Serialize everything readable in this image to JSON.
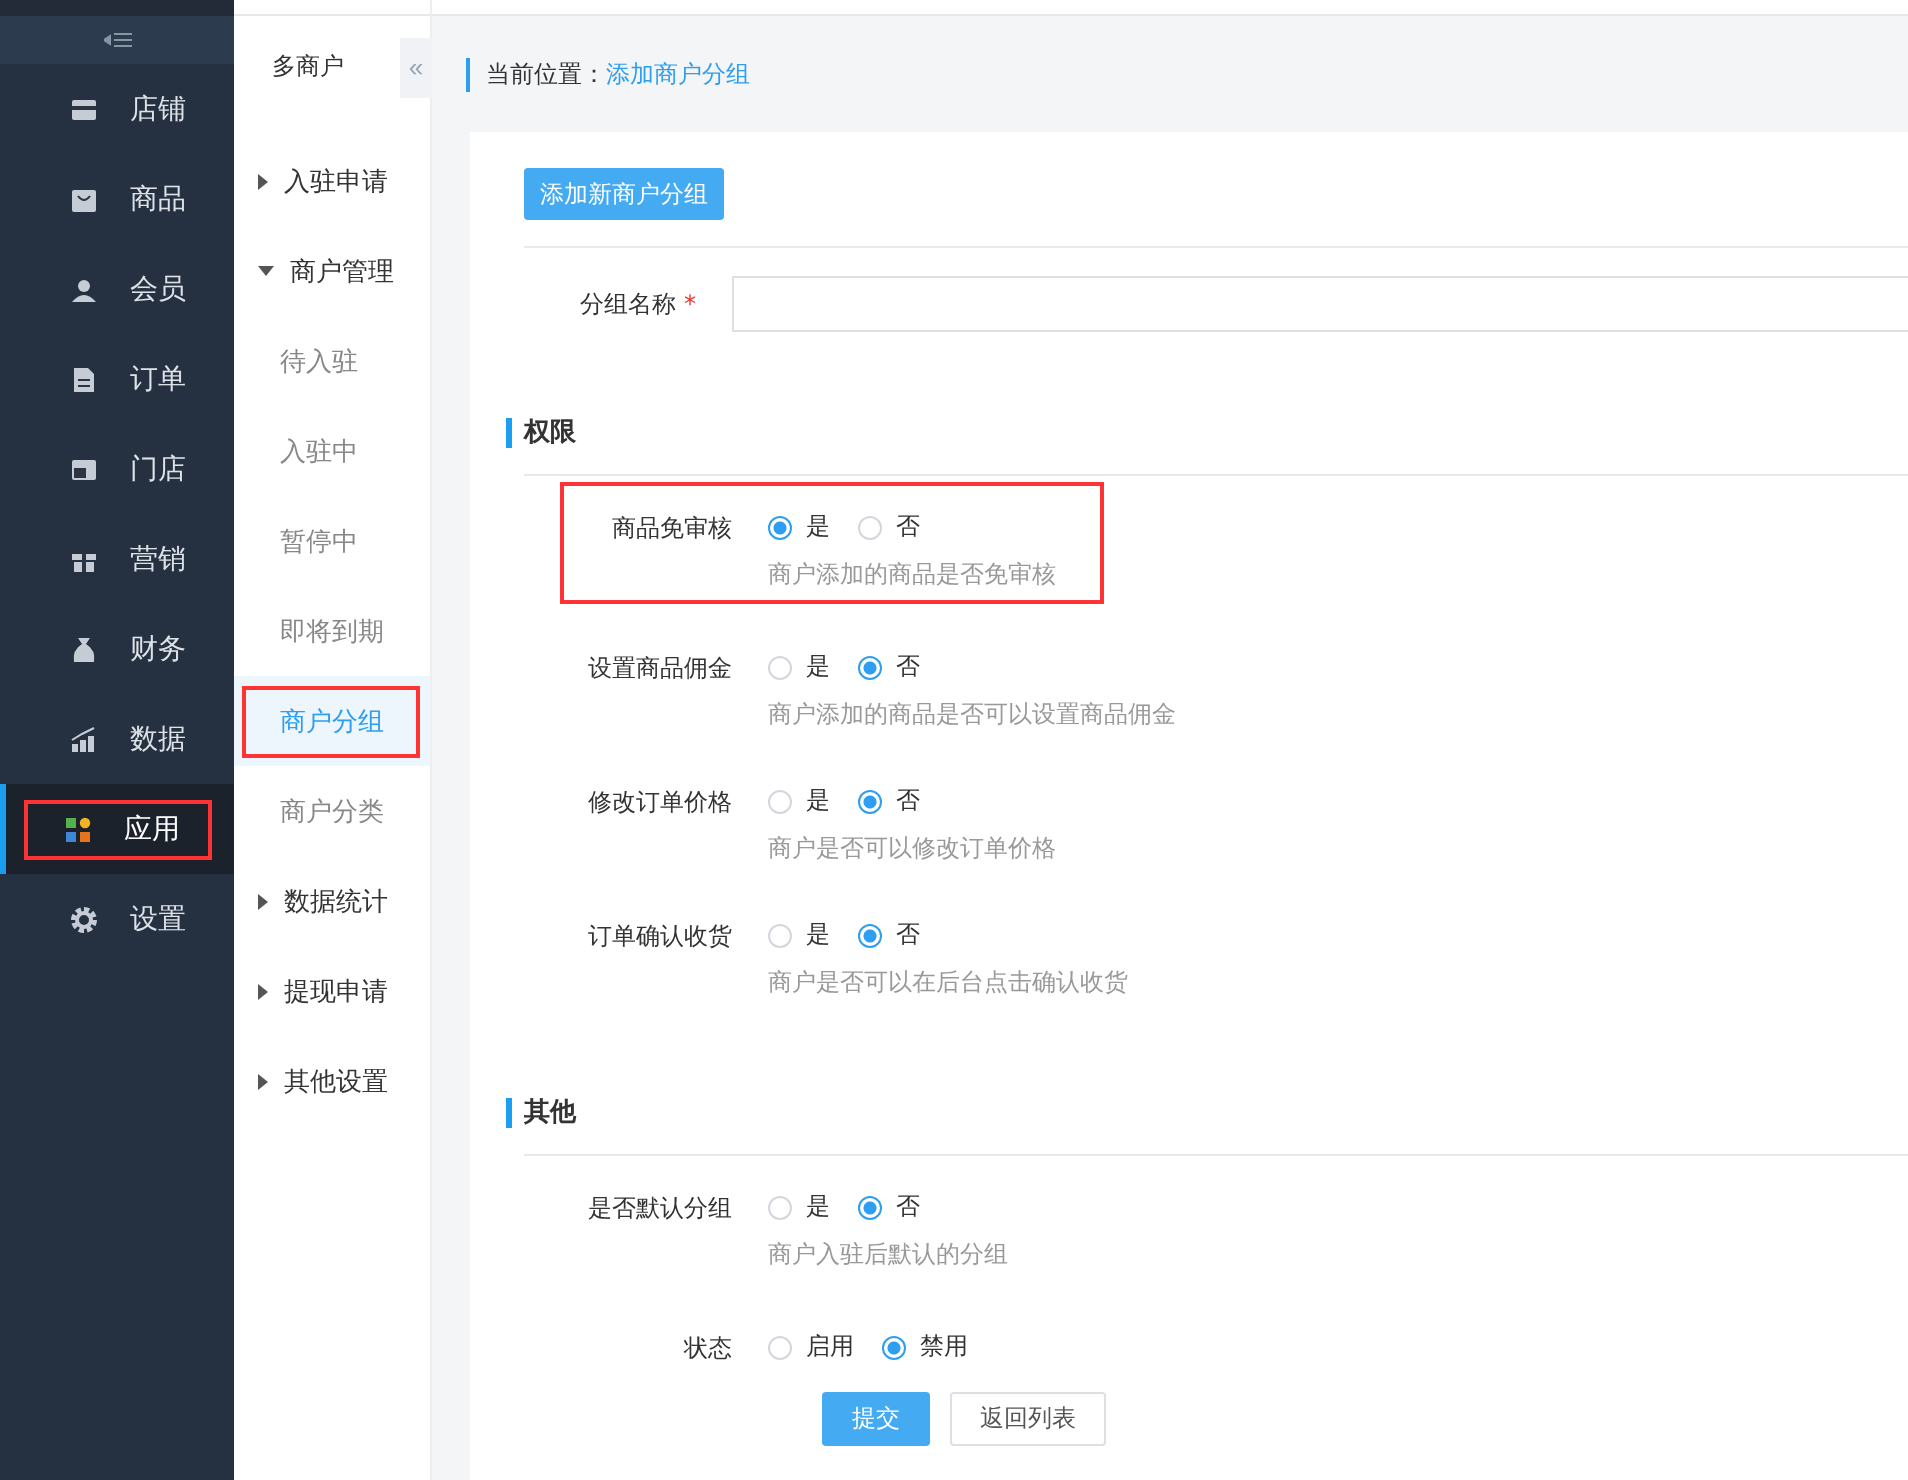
{
  "nav": {
    "items": [
      {
        "label": "店铺",
        "selected": false,
        "highlighted": false
      },
      {
        "label": "商品",
        "selected": false,
        "highlighted": false
      },
      {
        "label": "会员",
        "selected": false,
        "highlighted": false
      },
      {
        "label": "订单",
        "selected": false,
        "highlighted": false
      },
      {
        "label": "门店",
        "selected": false,
        "highlighted": false
      },
      {
        "label": "营销",
        "selected": false,
        "highlighted": false
      },
      {
        "label": "财务",
        "selected": false,
        "highlighted": false
      },
      {
        "label": "数据",
        "selected": false,
        "highlighted": false
      },
      {
        "label": "应用",
        "selected": true,
        "highlighted": true
      },
      {
        "label": "设置",
        "selected": false,
        "highlighted": false
      }
    ]
  },
  "subnav": {
    "title": "多商户",
    "collapse": "«",
    "items": [
      {
        "label": "入驻申请",
        "kind": "group",
        "expanded": false
      },
      {
        "label": "商户管理",
        "kind": "group",
        "expanded": true,
        "children": [
          {
            "label": "待入驻",
            "selected": false,
            "highlighted": false
          },
          {
            "label": "入驻中",
            "selected": false,
            "highlighted": false
          },
          {
            "label": "暂停中",
            "selected": false,
            "highlighted": false
          },
          {
            "label": "即将到期",
            "selected": false,
            "highlighted": false
          },
          {
            "label": "商户分组",
            "selected": true,
            "highlighted": true
          },
          {
            "label": "商户分类",
            "selected": false,
            "highlighted": false
          }
        ]
      },
      {
        "label": "数据统计",
        "kind": "group",
        "expanded": false
      },
      {
        "label": "提现申请",
        "kind": "group",
        "expanded": false
      },
      {
        "label": "其他设置",
        "kind": "group",
        "expanded": false
      }
    ]
  },
  "breadcrumb": {
    "prefix": "当前位置：",
    "current": "添加商户分组"
  },
  "add_button": "添加新商户分组",
  "name_field": {
    "label": "分组名称",
    "required_mark": "*"
  },
  "sections": [
    {
      "title": "权限",
      "rows": [
        {
          "label": "商品免审核",
          "hint": "商户添加的商品是否免审核",
          "highlighted": true,
          "options": [
            {
              "label": "是",
              "selected": true
            },
            {
              "label": "否",
              "selected": false
            }
          ]
        },
        {
          "label": "设置商品佣金",
          "hint": "商户添加的商品是否可以设置商品佣金",
          "highlighted": false,
          "options": [
            {
              "label": "是",
              "selected": false
            },
            {
              "label": "否",
              "selected": true
            }
          ]
        },
        {
          "label": "修改订单价格",
          "hint": "商户是否可以修改订单价格",
          "highlighted": false,
          "options": [
            {
              "label": "是",
              "selected": false
            },
            {
              "label": "否",
              "selected": true
            }
          ]
        },
        {
          "label": "订单确认收货",
          "hint": "商户是否可以在后台点击确认收货",
          "highlighted": false,
          "options": [
            {
              "label": "是",
              "selected": false
            },
            {
              "label": "否",
              "selected": true
            }
          ]
        }
      ]
    },
    {
      "title": "其他",
      "rows": [
        {
          "label": "是否默认分组",
          "hint": "商户入驻后默认的分组",
          "highlighted": false,
          "options": [
            {
              "label": "是",
              "selected": false
            },
            {
              "label": "否",
              "selected": true
            }
          ]
        },
        {
          "label": "状态",
          "highlighted": false,
          "options": [
            {
              "label": "启用",
              "selected": false
            },
            {
              "label": "禁用",
              "selected": true
            }
          ]
        }
      ]
    }
  ],
  "actions": [
    {
      "label": "提交",
      "kind": "primary"
    },
    {
      "label": "返回列表",
      "kind": "default"
    }
  ]
}
